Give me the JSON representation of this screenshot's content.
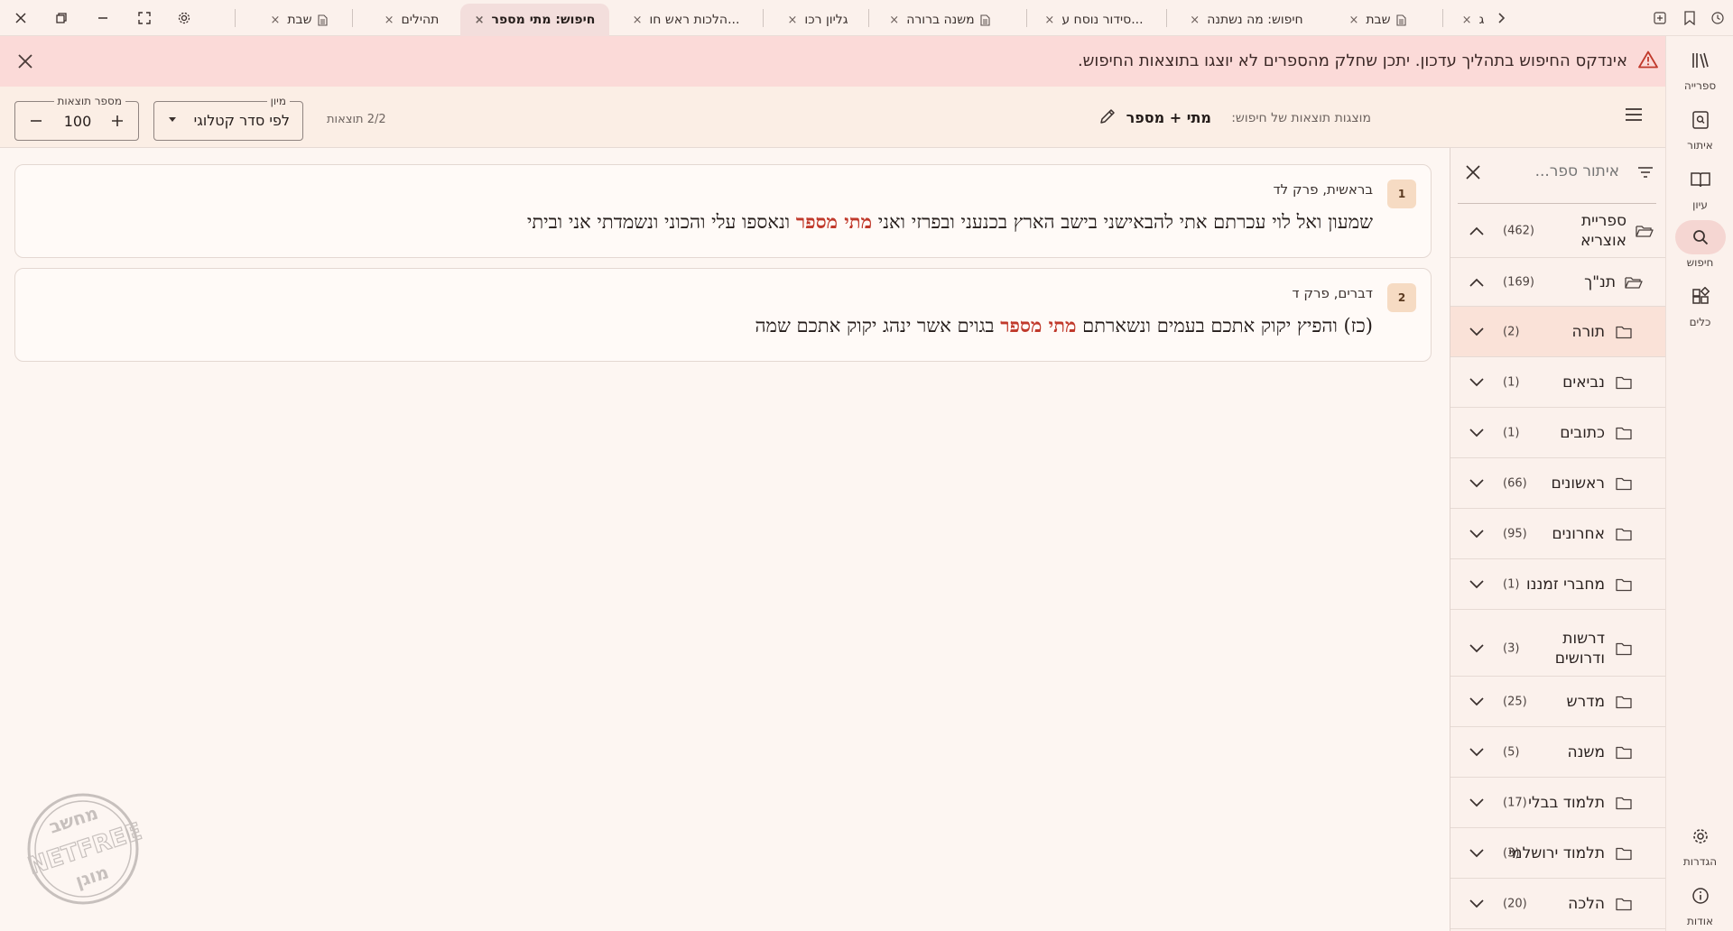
{
  "window_controls": {
    "close": "close-icon",
    "restore": "restore-icon",
    "minimize": "minimize-icon",
    "fullscreen": "fullscreen-icon",
    "settings": "gear-icon"
  },
  "tabs": [
    {
      "label": "שבת",
      "has_doc_icon": true,
      "active": false
    },
    {
      "label": "תהילים",
      "has_doc_icon": false,
      "active": false
    },
    {
      "label": "חיפוש: מתי מספר",
      "has_doc_icon": false,
      "active": true
    },
    {
      "label": "הלכות ראש חו...",
      "has_doc_icon": false,
      "active": false
    },
    {
      "label": "גליון רכו",
      "has_doc_icon": false,
      "active": false
    },
    {
      "label": "משנה ברורה",
      "has_doc_icon": true,
      "active": false
    },
    {
      "label": "סידור נוסח ע...",
      "has_doc_icon": false,
      "active": false
    },
    {
      "label": "חיפוש: מה נשתנה",
      "has_doc_icon": false,
      "active": false
    },
    {
      "label": "שבת",
      "has_doc_icon": true,
      "active": false
    },
    {
      "label": "ג",
      "has_doc_icon": false,
      "active": false
    }
  ],
  "tab_close_glyph": "×",
  "banner": {
    "text": "אינדקס החיפוש בתהליך עדכון. יתכן שחלק מהספרים לא יוצגו בתוצאות החיפוש.",
    "bg_color": "#fbdad8",
    "icon": "warning-icon"
  },
  "rail": {
    "items": [
      {
        "label": "ספרייה",
        "icon": "library-icon",
        "active": false
      },
      {
        "label": "איתור",
        "icon": "locate-icon",
        "active": false
      },
      {
        "label": "עיון",
        "icon": "book-open-icon",
        "active": false
      },
      {
        "label": "חיפוש",
        "icon": "search-icon",
        "active": true
      },
      {
        "label": "כלים",
        "icon": "tools-icon",
        "active": false
      }
    ],
    "bottom_items": [
      {
        "label": "הגדרות",
        "icon": "gear-icon"
      },
      {
        "label": "אודות",
        "icon": "info-icon"
      }
    ]
  },
  "header": {
    "query_label": "מוצגות תוצאות של חיפוש:",
    "query_value": "מתי + מספר",
    "results_count": "2/2 תוצאות",
    "sort": {
      "legend": "מיון",
      "value": "לפי סדר קטלוגי"
    },
    "result_limit": {
      "legend": "מספר תוצאות",
      "value": "100"
    }
  },
  "results": [
    {
      "number": "1",
      "reference": "בראשית, פרק לד",
      "text_before": "שמעון ואל לוי עכרתם אתי להבאישני בישב הארץ בכנעני ובפרזי ואני ",
      "highlight": "מתי מספר",
      "text_after": " ונאספו עלי והכוני ונשמדתי אני וביתי"
    },
    {
      "number": "2",
      "reference": "דברים, פרק ד",
      "text_before": "(כז) והפיץ יקוק אתכם בעמים ונשארתם ",
      "highlight": "מתי מספר",
      "text_after": " בגוים אשר ינהג יקוק אתכם שמה"
    }
  ],
  "highlight_color": "#c0392b",
  "filter": {
    "placeholder": "איתור ספר...",
    "tree": [
      {
        "label": "ספריית אוצריא",
        "count": "(462)",
        "expanded": true,
        "open_folder": true,
        "selected": false
      },
      {
        "label": "תנ\"ך",
        "count": "(169)",
        "expanded": true,
        "open_folder": true,
        "selected": false
      },
      {
        "label": "תורה",
        "count": "(2)",
        "expanded": false,
        "open_folder": false,
        "selected": true
      },
      {
        "label": "נביאים",
        "count": "(1)",
        "expanded": false,
        "open_folder": false,
        "selected": false
      },
      {
        "label": "כתובים",
        "count": "(1)",
        "expanded": false,
        "open_folder": false,
        "selected": false
      },
      {
        "label": "ראשונים",
        "count": "(66)",
        "expanded": false,
        "open_folder": false,
        "selected": false
      },
      {
        "label": "אחרונים",
        "count": "(95)",
        "expanded": false,
        "open_folder": false,
        "selected": false
      },
      {
        "label": "מחברי זמננו",
        "count": "(1)",
        "expanded": false,
        "open_folder": false,
        "selected": false
      },
      {
        "label": "דרשות ודרושים",
        "count": "(3)",
        "expanded": false,
        "open_folder": false,
        "selected": false
      },
      {
        "label": "מדרש",
        "count": "(25)",
        "expanded": false,
        "open_folder": false,
        "selected": false
      },
      {
        "label": "משנה",
        "count": "(5)",
        "expanded": false,
        "open_folder": false,
        "selected": false
      },
      {
        "label": "תלמוד בבלי",
        "count": "(17)",
        "expanded": false,
        "open_folder": false,
        "selected": false
      },
      {
        "label": "תלמוד ירושלמי",
        "count": "(3)",
        "expanded": false,
        "open_folder": false,
        "selected": false
      },
      {
        "label": "הלכה",
        "count": "(20)",
        "expanded": false,
        "open_folder": false,
        "selected": false
      }
    ]
  },
  "watermark": {
    "top": "מחשב",
    "middle": "NETFREE",
    "bottom": "מוגן"
  }
}
